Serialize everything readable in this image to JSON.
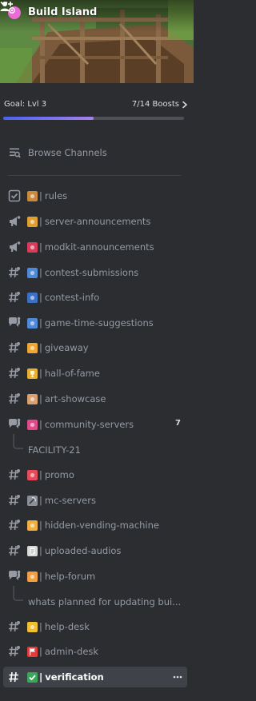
{
  "server": {
    "name": "Build Island"
  },
  "boost": {
    "goal_label": "Goal: Lvl 3",
    "progress_label": "7/14 Boosts",
    "current": 7,
    "target": 14,
    "colors": {
      "start": "#4a63ee",
      "end": "#a680ee"
    }
  },
  "browse": {
    "label": "Browse Channels"
  },
  "channels": [
    {
      "icon": "rules-icon",
      "emoji": "scroll",
      "emoji_bg": "#c98a3a",
      "name": "rules"
    },
    {
      "icon": "announcement-icon",
      "emoji": "bell",
      "emoji_bg": "#e0a030",
      "name": "server-announcements"
    },
    {
      "icon": "announcement-icon",
      "emoji": "robot",
      "emoji_bg": "#d83c5a",
      "name": "modkit-announcements"
    },
    {
      "icon": "text-channel-icon",
      "emoji": "ballot-box",
      "emoji_bg": "#4f8ad8",
      "name": "contest-submissions"
    },
    {
      "icon": "text-channel-icon",
      "emoji": "mailbox",
      "emoji_bg": "#3c70c8",
      "name": "contest-info"
    },
    {
      "icon": "forum-icon",
      "emoji": "ballot-box",
      "emoji_bg": "#4f8ad8",
      "name": "game-time-suggestions"
    },
    {
      "icon": "text-channel-icon",
      "emoji": "smiling-hearts",
      "emoji_bg": "#f0a630",
      "name": "giveaway"
    },
    {
      "icon": "text-channel-icon",
      "emoji": "trophy",
      "emoji_bg": "#e8b030",
      "name": "hall-of-fame"
    },
    {
      "icon": "text-channel-icon",
      "emoji": "palette",
      "emoji_bg": "#d9a070",
      "name": "art-showcase"
    },
    {
      "icon": "forum-icon",
      "emoji": "two-hearts",
      "emoji_bg": "#e04a8a",
      "name": "community-servers",
      "count": "7"
    },
    {
      "icon": "text-channel-icon",
      "emoji": "loudspeaker",
      "emoji_bg": "#e84a5a",
      "name": "promo"
    },
    {
      "icon": "text-channel-icon",
      "emoji": "pick",
      "emoji_bg": "#8a8f98",
      "name": "mc-servers"
    },
    {
      "icon": "text-channel-icon",
      "emoji": "shushing-face",
      "emoji_bg": "#f0b040",
      "name": "hidden-vending-machine"
    },
    {
      "icon": "text-channel-icon",
      "emoji": "page",
      "emoji_bg": "#d8d8d8",
      "name": "uploaded-audios"
    },
    {
      "icon": "forum-icon",
      "emoji": "raising-hand",
      "emoji_bg": "#f0a040",
      "name": "help-forum"
    },
    {
      "icon": "text-channel-icon",
      "emoji": "bell",
      "emoji_bg": "#f0c030",
      "name": "help-desk"
    },
    {
      "icon": "text-channel-icon",
      "emoji": "red-flag",
      "emoji_bg": "#e03c3c",
      "name": "admin-desk"
    },
    {
      "icon": "text-channel-icon",
      "emoji": "check-mark",
      "emoji_bg": "#3ba55c",
      "name": "verification",
      "selected": true
    }
  ],
  "threads": [
    {
      "name": "FACILITY-21"
    },
    {
      "name": "whats planned for updating bui..."
    }
  ],
  "separator": "|"
}
